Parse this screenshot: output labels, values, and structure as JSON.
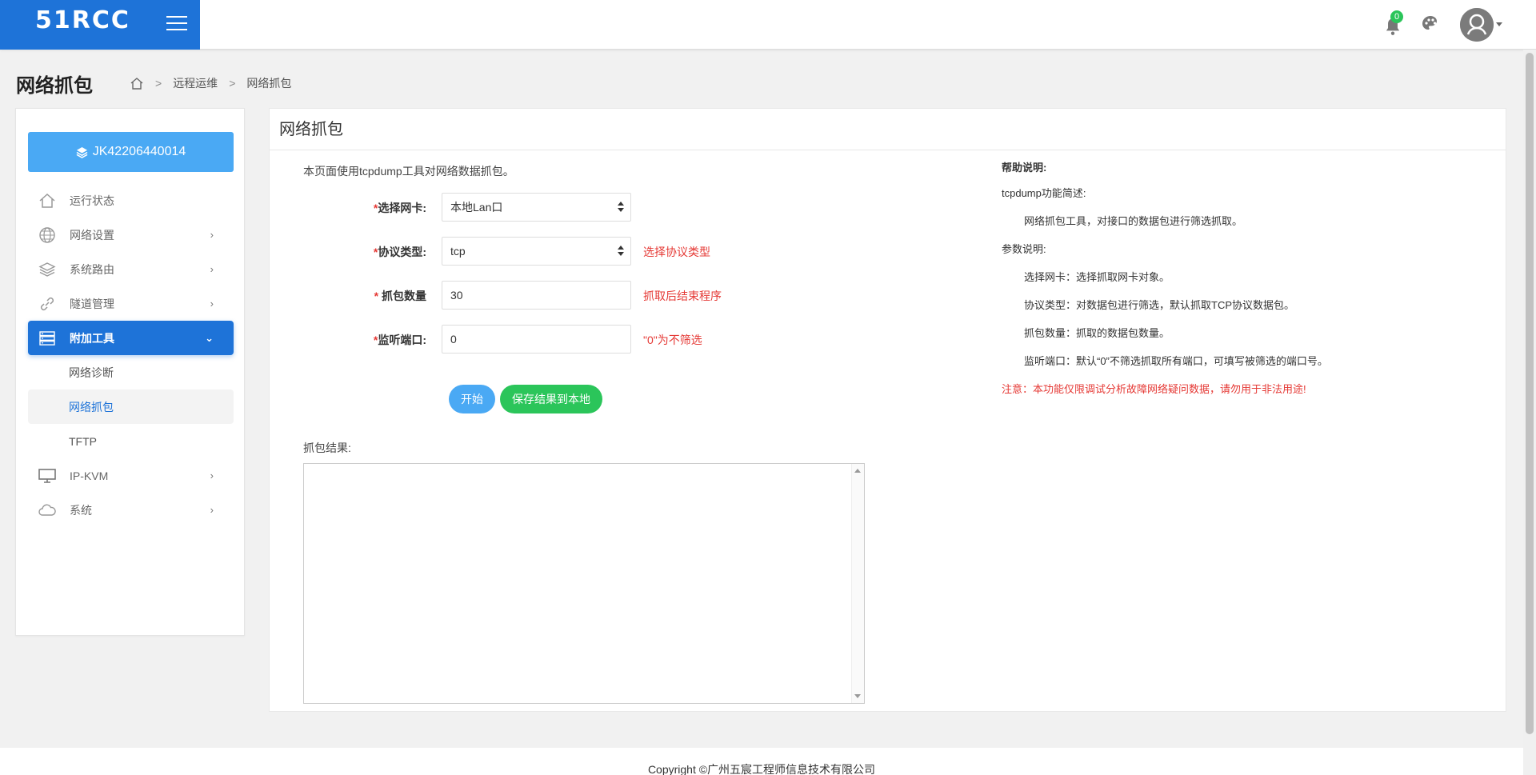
{
  "header": {
    "logo_text": "51RCC",
    "notification_count": "0"
  },
  "page": {
    "title": "网络抓包",
    "breadcrumb": [
      "远程运维",
      "网络抓包"
    ]
  },
  "sidebar": {
    "device_id": "JK42206440014",
    "items": [
      {
        "label": "运行状态"
      },
      {
        "label": "网络设置"
      },
      {
        "label": "系统路由"
      },
      {
        "label": "隧道管理"
      },
      {
        "label": "附加工具"
      },
      {
        "label": "IP-KVM"
      },
      {
        "label": "系统"
      }
    ],
    "subitems": [
      {
        "label": "网络诊断"
      },
      {
        "label": "网络抓包"
      },
      {
        "label": "TFTP"
      }
    ]
  },
  "card": {
    "title": "网络抓包",
    "intro": "本页面使用tcpdump工具对网络数据抓包。",
    "form": {
      "nic_label": "选择网卡:",
      "nic_value": "本地Lan口",
      "protocol_label": "协议类型:",
      "protocol_value": "tcp",
      "protocol_hint": "选择协议类型",
      "count_label": "抓包数量",
      "count_value": "30",
      "count_hint": "抓取后结束程序",
      "port_label": "监听端口:",
      "port_value": "0",
      "port_hint": "\"0\"为不筛选",
      "required_mark": "*"
    },
    "buttons": {
      "start": "开始",
      "save": "保存结果到本地"
    },
    "result_label": "抓包结果:",
    "result_value": ""
  },
  "help": {
    "title": "帮助说明:",
    "overview_title": "tcpdump功能简述:",
    "overview_text": "网络抓包工具，对接口的数据包进行筛选抓取。",
    "params_title": "参数说明:",
    "param_nic": "选择网卡：选择抓取网卡对象。",
    "param_protocol": "协议类型：对数据包进行筛选，默认抓取TCP协议数据包。",
    "param_count": "抓包数量：抓取的数据包数量。",
    "param_port": "监听端口：默认“0”不筛选抓取所有端口，可填写被筛选的端口号。",
    "warning": "注意：本功能仅限调试分析故障网络疑问数据，请勿用于非法用途!"
  },
  "footer": {
    "copyright": "Copyright ©广州五宸工程师信息技术有限公司"
  },
  "colors": {
    "brand": "#1e73d8",
    "start_button": "#4aa9f4",
    "save_button": "#2bc55a",
    "warning": "#e53935"
  }
}
